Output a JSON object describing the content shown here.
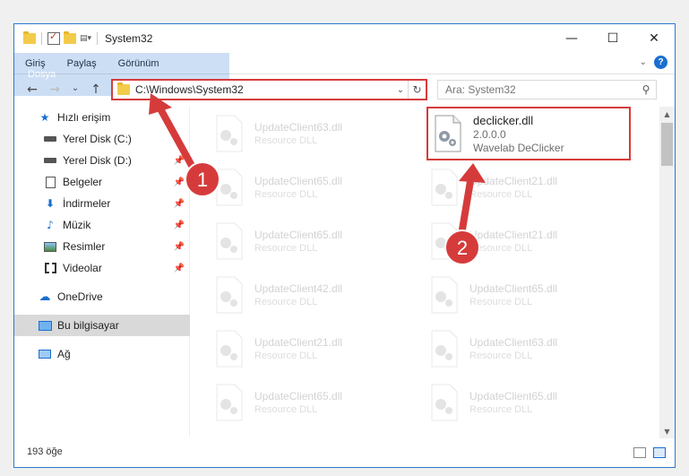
{
  "window": {
    "title": "System32",
    "controls": {
      "minimize": "—",
      "maximize": "☐",
      "close": "✕"
    }
  },
  "ribbon": {
    "tabs": [
      "Dosya",
      "Giriş",
      "Paylaş",
      "Görünüm"
    ],
    "help": "?"
  },
  "navigation": {
    "back": "←",
    "forward": "→",
    "recent": "⌄",
    "up": "↑",
    "address": "C:\\Windows\\System32",
    "dropdown": "⌄",
    "refresh": "↻",
    "search_placeholder": "Ara: System32"
  },
  "sidebar": {
    "items": [
      {
        "label": "Hızlı erişim",
        "icon": "star-icon"
      },
      {
        "label": "Yerel Disk (C:)",
        "icon": "drive-icon"
      },
      {
        "label": "Yerel Disk (D:)",
        "icon": "drive-icon"
      },
      {
        "label": "Belgeler",
        "icon": "documents-icon"
      },
      {
        "label": "İndirmeler",
        "icon": "download-icon"
      },
      {
        "label": "Müzik",
        "icon": "music-icon"
      },
      {
        "label": "Resimler",
        "icon": "pictures-icon"
      },
      {
        "label": "Videolar",
        "icon": "videos-icon"
      },
      {
        "label": "OneDrive",
        "icon": "cloud-icon"
      },
      {
        "label": "Bu bilgisayar",
        "icon": "computer-icon"
      },
      {
        "label": "Ağ",
        "icon": "network-icon"
      }
    ]
  },
  "files": {
    "left": [
      {
        "name": "UpdateClient63.dll",
        "desc": "Resource DLL"
      },
      {
        "name": "UpdateClient65.dll",
        "desc": "Resource DLL"
      },
      {
        "name": "UpdateClient65.dll",
        "desc": "Resource DLL"
      },
      {
        "name": "UpdateClient42.dll",
        "desc": "Resource DLL"
      },
      {
        "name": "UpdateClient21.dll",
        "desc": "Resource DLL"
      },
      {
        "name": "UpdateClient65.dll",
        "desc": "Resource DLL"
      }
    ],
    "right": [
      {
        "name": "declicker.dll",
        "version": "2.0.0.0",
        "desc": "Wavelab DeClicker"
      },
      {
        "name": "UpdateClient21.dll",
        "desc": "Resource DLL"
      },
      {
        "name": "UpdateClient21.dll",
        "desc": "Resource DLL"
      },
      {
        "name": "UpdateClient65.dll",
        "desc": "Resource DLL"
      },
      {
        "name": "UpdateClient63.dll",
        "desc": "Resource DLL"
      },
      {
        "name": "UpdateClient65.dll",
        "desc": "Resource DLL"
      }
    ]
  },
  "status": {
    "count": "193 öğe"
  },
  "annotations": {
    "step1": "1",
    "step2": "2",
    "color": "#d63b3b"
  }
}
